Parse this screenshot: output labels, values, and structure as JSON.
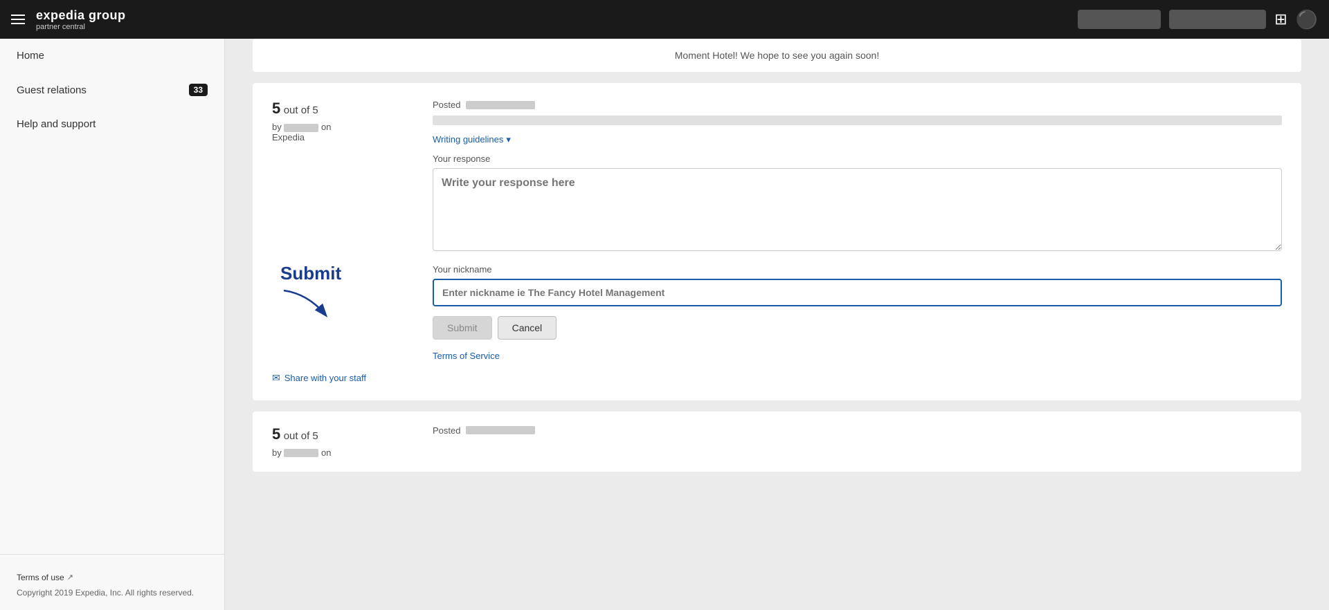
{
  "topnav": {
    "hamburger_label": "Menu",
    "logo_main": "expedia group",
    "logo_sub": "partner central",
    "grid_icon": "⊞",
    "user_icon": "👤"
  },
  "sidebar": {
    "home_label": "Home",
    "guest_relations_label": "Guest relations",
    "guest_relations_badge": "33",
    "help_support_label": "Help and support",
    "terms_label": "Terms of use",
    "copyright": "Copyright 2019 Expedia, Inc. All rights reserved."
  },
  "top_partial": {
    "text": "Moment Hotel! We hope to see you again soon!"
  },
  "review1": {
    "score": "5",
    "out_of": "out of 5",
    "by_label": "by",
    "on_label": "on",
    "platform": "Expedia",
    "posted_label": "Posted",
    "writing_guidelines_label": "Writing guidelines",
    "your_response_label": "Your response",
    "response_placeholder": "Write your response here",
    "nickname_label": "Your nickname",
    "nickname_placeholder": "Enter nickname ie The Fancy Hotel Management",
    "submit_label": "Submit",
    "cancel_label": "Cancel",
    "terms_of_service_label": "Terms of Service",
    "share_staff_label": "Share with your staff"
  },
  "submit_annotation": {
    "text": "Submit"
  },
  "review2": {
    "score": "5",
    "out_of": "out of 5",
    "by_label": "by",
    "on_label": "on",
    "posted_label": "Posted"
  }
}
